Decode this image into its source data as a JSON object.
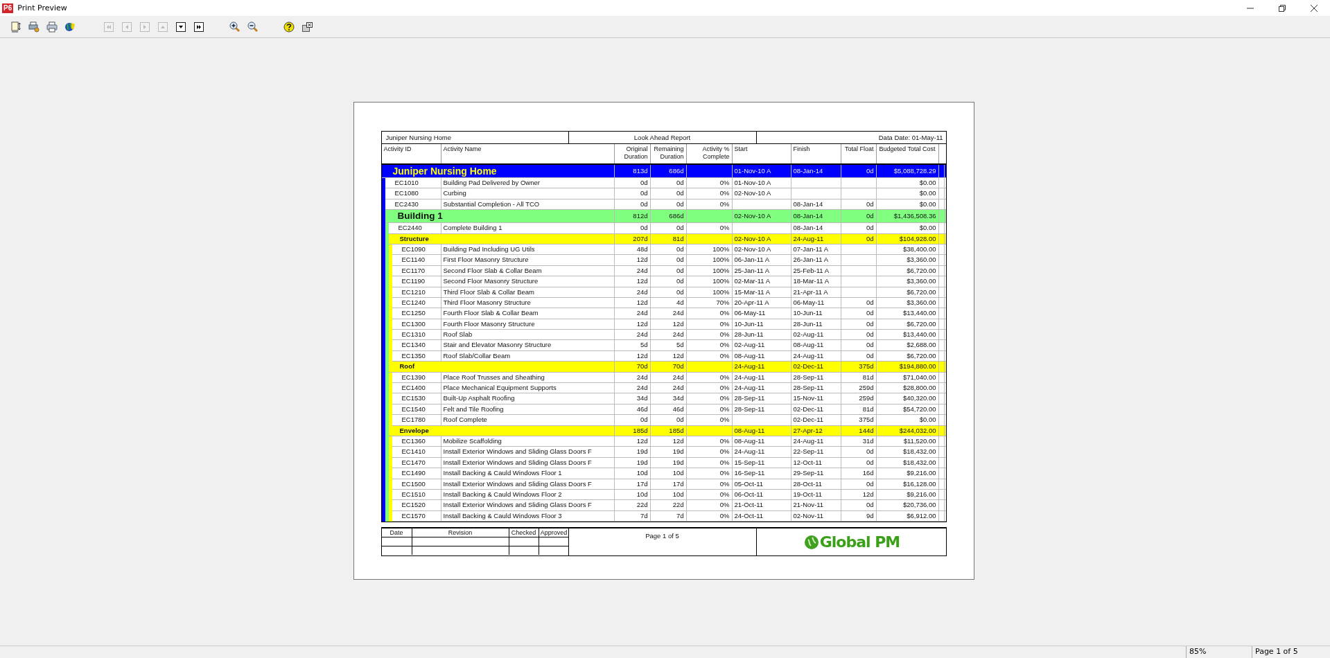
{
  "window": {
    "title": "Print Preview",
    "app_badge": "P6"
  },
  "toolbar": [
    {
      "kind": "page-setup",
      "disabled": false
    },
    {
      "kind": "print-setup",
      "disabled": false
    },
    {
      "kind": "print",
      "disabled": false
    },
    {
      "kind": "colors",
      "disabled": false
    },
    {
      "kind": "first",
      "disabled": true
    },
    {
      "kind": "prev",
      "disabled": true
    },
    {
      "kind": "next",
      "disabled": true
    },
    {
      "kind": "up",
      "disabled": true
    },
    {
      "kind": "down",
      "disabled": false
    },
    {
      "kind": "last",
      "disabled": false
    },
    {
      "kind": "zoom-in",
      "disabled": false
    },
    {
      "kind": "zoom-out",
      "disabled": false
    },
    {
      "kind": "help",
      "disabled": false
    },
    {
      "kind": "close",
      "disabled": false
    }
  ],
  "report": {
    "header": {
      "project": "Juniper Nursing Home",
      "title": "Look Ahead Report",
      "data_date": "Data Date: 01-May-11"
    },
    "columns": [
      "Activity ID",
      "Activity Name",
      "Original Duration",
      "Remaining Duration",
      "Activity % Complete",
      "Start",
      "Finish",
      "Total Float",
      "Budgeted Total Cost"
    ],
    "wbs": {
      "name": "Juniper Nursing Home",
      "color": "#0000ff",
      "original_duration": "813d",
      "remaining_duration": "686d",
      "start": "01-Nov-10 A",
      "finish": "08-Jan-14",
      "total_float": "0d",
      "budgeted_cost": "$5,088,728.29",
      "activities": [
        {
          "id": "EC1010",
          "name": "Building Pad Delivered by Owner",
          "original_duration": "0d",
          "remaining_duration": "0d",
          "percent_complete": "0%",
          "start": "01-Nov-10 A",
          "budgeted_cost": "$0.00"
        },
        {
          "id": "EC1080",
          "name": "Curbing",
          "original_duration": "0d",
          "remaining_duration": "0d",
          "percent_complete": "0%",
          "start": "02-Nov-10 A",
          "budgeted_cost": "$0.00"
        },
        {
          "id": "EC2430",
          "name": "Substantial Completion - All TCO",
          "original_duration": "0d",
          "remaining_duration": "0d",
          "percent_complete": "0%",
          "finish": "08-Jan-14",
          "total_float": "0d",
          "budgeted_cost": "$0.00"
        }
      ],
      "children": [
        {
          "name": "Building 1",
          "color": "#80ff80",
          "original_duration": "812d",
          "remaining_duration": "686d",
          "start": "02-Nov-10 A",
          "finish": "08-Jan-14",
          "total_float": "0d",
          "budgeted_cost": "$1,436,508.36",
          "activities": [
            {
              "id": "EC2440",
              "name": "Complete Building 1",
              "original_duration": "0d",
              "remaining_duration": "0d",
              "percent_complete": "0%",
              "finish": "08-Jan-14",
              "total_float": "0d",
              "budgeted_cost": "$0.00"
            }
          ],
          "children": [
            {
              "name": "Structure",
              "color": "#ffff00",
              "original_duration": "207d",
              "remaining_duration": "81d",
              "start": "02-Nov-10 A",
              "finish": "24-Aug-11",
              "total_float": "0d",
              "budgeted_cost": "$104,928.00",
              "activities": [
                {
                  "id": "EC1090",
                  "name": "Building Pad Including UG Utils",
                  "original_duration": "48d",
                  "remaining_duration": "0d",
                  "percent_complete": "100%",
                  "start": "02-Nov-10 A",
                  "finish": "07-Jan-11 A",
                  "budgeted_cost": "$38,400.00"
                },
                {
                  "id": "EC1140",
                  "name": "First Floor Masonry Structure",
                  "original_duration": "12d",
                  "remaining_duration": "0d",
                  "percent_complete": "100%",
                  "start": "06-Jan-11 A",
                  "finish": "26-Jan-11 A",
                  "budgeted_cost": "$3,360.00"
                },
                {
                  "id": "EC1170",
                  "name": "Second Floor Slab & Collar Beam",
                  "original_duration": "24d",
                  "remaining_duration": "0d",
                  "percent_complete": "100%",
                  "start": "25-Jan-11 A",
                  "finish": "25-Feb-11 A",
                  "budgeted_cost": "$6,720.00"
                },
                {
                  "id": "EC1190",
                  "name": "Second Floor Masonry Structure",
                  "original_duration": "12d",
                  "remaining_duration": "0d",
                  "percent_complete": "100%",
                  "start": "02-Mar-11 A",
                  "finish": "18-Mar-11 A",
                  "budgeted_cost": "$3,360.00"
                },
                {
                  "id": "EC1210",
                  "name": "Third Floor Slab & Collar Beam",
                  "original_duration": "24d",
                  "remaining_duration": "0d",
                  "percent_complete": "100%",
                  "start": "15-Mar-11 A",
                  "finish": "21-Apr-11 A",
                  "budgeted_cost": "$6,720.00"
                },
                {
                  "id": "EC1240",
                  "name": "Third Floor Masonry Structure",
                  "original_duration": "12d",
                  "remaining_duration": "4d",
                  "percent_complete": "70%",
                  "start": "20-Apr-11 A",
                  "finish": "06-May-11",
                  "total_float": "0d",
                  "budgeted_cost": "$3,360.00"
                },
                {
                  "id": "EC1250",
                  "name": "Fourth Floor Slab & Collar Beam",
                  "original_duration": "24d",
                  "remaining_duration": "24d",
                  "percent_complete": "0%",
                  "start": "06-May-11",
                  "finish": "10-Jun-11",
                  "total_float": "0d",
                  "budgeted_cost": "$13,440.00"
                },
                {
                  "id": "EC1300",
                  "name": "Fourth Floor Masonry Structure",
                  "original_duration": "12d",
                  "remaining_duration": "12d",
                  "percent_complete": "0%",
                  "start": "10-Jun-11",
                  "finish": "28-Jun-11",
                  "total_float": "0d",
                  "budgeted_cost": "$6,720.00"
                },
                {
                  "id": "EC1310",
                  "name": "Roof Slab",
                  "original_duration": "24d",
                  "remaining_duration": "24d",
                  "percent_complete": "0%",
                  "start": "28-Jun-11",
                  "finish": "02-Aug-11",
                  "total_float": "0d",
                  "budgeted_cost": "$13,440.00"
                },
                {
                  "id": "EC1340",
                  "name": "Stair and Elevator Masonry Structure",
                  "original_duration": "5d",
                  "remaining_duration": "5d",
                  "percent_complete": "0%",
                  "start": "02-Aug-11",
                  "finish": "08-Aug-11",
                  "total_float": "0d",
                  "budgeted_cost": "$2,688.00"
                },
                {
                  "id": "EC1350",
                  "name": "Roof Slab/Collar Beam",
                  "original_duration": "12d",
                  "remaining_duration": "12d",
                  "percent_complete": "0%",
                  "start": "08-Aug-11",
                  "finish": "24-Aug-11",
                  "total_float": "0d",
                  "budgeted_cost": "$6,720.00"
                }
              ]
            },
            {
              "name": "Roof",
              "color": "#ffff00",
              "original_duration": "70d",
              "remaining_duration": "70d",
              "start": "24-Aug-11",
              "finish": "02-Dec-11",
              "total_float": "375d",
              "budgeted_cost": "$194,880.00",
              "activities": [
                {
                  "id": "EC1390",
                  "name": "Place Roof Trusses and Sheathing",
                  "original_duration": "24d",
                  "remaining_duration": "24d",
                  "percent_complete": "0%",
                  "start": "24-Aug-11",
                  "finish": "28-Sep-11",
                  "total_float": "81d",
                  "budgeted_cost": "$71,040.00"
                },
                {
                  "id": "EC1400",
                  "name": "Place Mechanical Equipment Supports",
                  "original_duration": "24d",
                  "remaining_duration": "24d",
                  "percent_complete": "0%",
                  "start": "24-Aug-11",
                  "finish": "28-Sep-11",
                  "total_float": "259d",
                  "budgeted_cost": "$28,800.00"
                },
                {
                  "id": "EC1530",
                  "name": "Built-Up Asphalt Roofing",
                  "original_duration": "34d",
                  "remaining_duration": "34d",
                  "percent_complete": "0%",
                  "start": "28-Sep-11",
                  "finish": "15-Nov-11",
                  "total_float": "259d",
                  "budgeted_cost": "$40,320.00"
                },
                {
                  "id": "EC1540",
                  "name": "Felt and Tile Roofing",
                  "original_duration": "46d",
                  "remaining_duration": "46d",
                  "percent_complete": "0%",
                  "start": "28-Sep-11",
                  "finish": "02-Dec-11",
                  "total_float": "81d",
                  "budgeted_cost": "$54,720.00"
                },
                {
                  "id": "EC1780",
                  "name": "Roof Complete",
                  "original_duration": "0d",
                  "remaining_duration": "0d",
                  "percent_complete": "0%",
                  "finish": "02-Dec-11",
                  "total_float": "375d",
                  "budgeted_cost": "$0.00"
                }
              ]
            },
            {
              "name": "Envelope",
              "color": "#ffff00",
              "original_duration": "185d",
              "remaining_duration": "185d",
              "start": "08-Aug-11",
              "finish": "27-Apr-12",
              "total_float": "144d",
              "budgeted_cost": "$244,032.00",
              "activities": [
                {
                  "id": "EC1360",
                  "name": "Mobilize Scaffolding",
                  "original_duration": "12d",
                  "remaining_duration": "12d",
                  "percent_complete": "0%",
                  "start": "08-Aug-11",
                  "finish": "24-Aug-11",
                  "total_float": "31d",
                  "budgeted_cost": "$11,520.00"
                },
                {
                  "id": "EC1410",
                  "name": "Install Exterior Windows and Sliding Glass Doors F",
                  "original_duration": "19d",
                  "remaining_duration": "19d",
                  "percent_complete": "0%",
                  "start": "24-Aug-11",
                  "finish": "22-Sep-11",
                  "total_float": "0d",
                  "budgeted_cost": "$18,432.00"
                },
                {
                  "id": "EC1470",
                  "name": "Install Exterior Windows and Sliding Glass Doors F",
                  "original_duration": "19d",
                  "remaining_duration": "19d",
                  "percent_complete": "0%",
                  "start": "15-Sep-11",
                  "finish": "12-Oct-11",
                  "total_float": "0d",
                  "budgeted_cost": "$18,432.00"
                },
                {
                  "id": "EC1490",
                  "name": "Install Backing & Cauld Windows Floor 1",
                  "original_duration": "10d",
                  "remaining_duration": "10d",
                  "percent_complete": "0%",
                  "start": "16-Sep-11",
                  "finish": "29-Sep-11",
                  "total_float": "16d",
                  "budgeted_cost": "$9,216.00"
                },
                {
                  "id": "EC1500",
                  "name": "Install Exterior Windows and Sliding Glass Doors F",
                  "original_duration": "17d",
                  "remaining_duration": "17d",
                  "percent_complete": "0%",
                  "start": "05-Oct-11",
                  "finish": "28-Oct-11",
                  "total_float": "0d",
                  "budgeted_cost": "$16,128.00"
                },
                {
                  "id": "EC1510",
                  "name": "Install Backing & Cauld Windows Floor 2",
                  "original_duration": "10d",
                  "remaining_duration": "10d",
                  "percent_complete": "0%",
                  "start": "06-Oct-11",
                  "finish": "19-Oct-11",
                  "total_float": "12d",
                  "budgeted_cost": "$9,216.00"
                },
                {
                  "id": "EC1520",
                  "name": "Install Exterior Windows and Sliding Glass Doors F",
                  "original_duration": "22d",
                  "remaining_duration": "22d",
                  "percent_complete": "0%",
                  "start": "21-Oct-11",
                  "finish": "21-Nov-11",
                  "total_float": "0d",
                  "budgeted_cost": "$20,736.00"
                },
                {
                  "id": "EC1570",
                  "name": "Install Backing & Cauld Windows Floor 3",
                  "original_duration": "7d",
                  "remaining_duration": "7d",
                  "percent_complete": "0%",
                  "start": "24-Oct-11",
                  "finish": "02-Nov-11",
                  "total_float": "9d",
                  "budgeted_cost": "$6,912.00"
                }
              ]
            }
          ]
        }
      ]
    },
    "footer": {
      "revision_columns": [
        "Date",
        "Revision",
        "Checked",
        "Approved"
      ],
      "page": "Page 1 of 5",
      "logo": "Global PM"
    }
  },
  "status_bar": {
    "zoom": "85%",
    "page": "Page 1 of 5"
  }
}
